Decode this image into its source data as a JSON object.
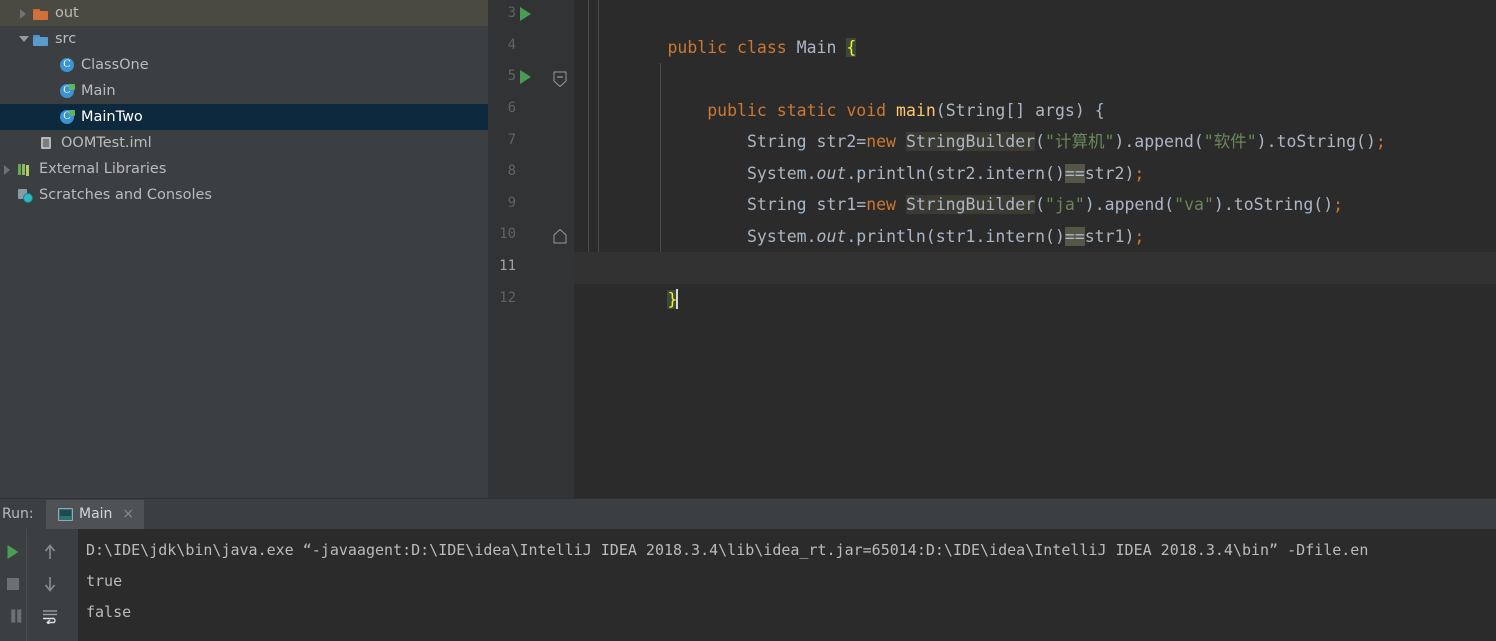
{
  "project_tree": {
    "items": [
      {
        "label": "out",
        "icon": "folder-orange-icon",
        "twisty": "collapsed",
        "indent": 16,
        "state": "hover"
      },
      {
        "label": "src",
        "icon": "folder-blue-icon",
        "twisty": "expanded",
        "indent": 16,
        "state": "normal"
      },
      {
        "label": "ClassOne",
        "icon": "java-class-icon",
        "twisty": "none",
        "indent": 58,
        "state": "normal"
      },
      {
        "label": "Main",
        "icon": "java-class-runnable-icon",
        "twisty": "none",
        "indent": 58,
        "state": "normal"
      },
      {
        "label": "MainTwo",
        "icon": "java-class-runnable-icon",
        "twisty": "none",
        "indent": 58,
        "state": "selected"
      },
      {
        "label": "OOMTest.iml",
        "icon": "module-iml-icon",
        "twisty": "none",
        "indent": 38,
        "state": "normal"
      },
      {
        "label": "External Libraries",
        "icon": "libraries-icon",
        "twisty": "collapsed",
        "indent": 16,
        "state": "normal"
      },
      {
        "label": "Scratches and Consoles",
        "icon": "scratches-icon",
        "twisty": "none",
        "indent": 16,
        "state": "normal"
      }
    ]
  },
  "editor": {
    "first_line": 3,
    "last_line": 12,
    "current_line": 11,
    "line_numbers": [
      "3",
      "4",
      "5",
      "6",
      "7",
      "8",
      "9",
      "10",
      "11",
      "12"
    ],
    "run_gutter_lines": [
      3,
      5
    ],
    "fold_lines": [
      5,
      10
    ],
    "lines": [
      {
        "n": 3,
        "indent": 0,
        "text": "public class Main {"
      },
      {
        "n": 4,
        "indent": 0,
        "text": ""
      },
      {
        "n": 5,
        "indent": 4,
        "text": "public static void main(String[] args) {"
      },
      {
        "n": 6,
        "indent": 8,
        "text": "String str2=new StringBuilder(\"计算机\").append(\"软件\").toString();"
      },
      {
        "n": 7,
        "indent": 8,
        "text": "System.out.println(str2.intern()==str2);"
      },
      {
        "n": 8,
        "indent": 8,
        "text": "String str1=new StringBuilder(\"ja\").append(\"va\").toString();"
      },
      {
        "n": 9,
        "indent": 8,
        "text": "System.out.println(str1.intern()==str1);"
      },
      {
        "n": 10,
        "indent": 4,
        "text": "}"
      },
      {
        "n": 11,
        "indent": 0,
        "text": "}"
      },
      {
        "n": 12,
        "indent": 0,
        "text": ""
      }
    ],
    "tokens": {
      "kw_public": "public",
      "kw_class": "class",
      "kw_static": "static",
      "kw_void": "void",
      "kw_new": "new",
      "type_main": "Main",
      "type_string": "String",
      "type_stringbuilder": "StringBuilder",
      "method_main": "main",
      "method_append": "append",
      "method_tostring": "toString",
      "method_intern": "intern",
      "method_println": "println",
      "field_out": "out",
      "class_system": "System",
      "var_args": "args",
      "var_str2": "str2",
      "var_str1": "str1",
      "str_jisuanji": "计算机",
      "str_ruanjian": "软件",
      "str_ja": "ja",
      "str_va": "va",
      "brace_open": "{",
      "brace_close": "}",
      "eq_eq": "==",
      "semi": ";"
    }
  },
  "run_panel": {
    "label": "Run:",
    "tab": {
      "title": "Main",
      "close": "×"
    },
    "toolbar": [
      {
        "name": "rerun-button",
        "icon": "run-icon"
      },
      {
        "name": "stop-button",
        "icon": "stop-icon"
      },
      {
        "name": "pause-button",
        "icon": "pause-icon"
      },
      {
        "name": "scroll-up-button",
        "icon": "arrow-up-icon"
      },
      {
        "name": "scroll-down-button",
        "icon": "arrow-down-icon"
      },
      {
        "name": "soft-wrap-button",
        "icon": "soft-wrap-icon"
      }
    ],
    "console_lines": [
      "D:\\IDE\\jdk\\bin\\java.exe “-javaagent:D:\\IDE\\idea\\IntelliJ IDEA 2018.3.4\\lib\\idea_rt.jar=65014:D:\\IDE\\idea\\IntelliJ IDEA 2018.3.4\\bin” -Dfile.en",
      "true",
      "false"
    ]
  },
  "colors": {
    "panel_bg": "#3c3f41",
    "editor_bg": "#2b2b2b",
    "gutter_bg": "#313335",
    "selection_bg": "#0d293e",
    "hover_bg": "#4a4a42",
    "keyword": "#cc7832",
    "string": "#6a8759",
    "method": "#ffc66d",
    "field": "#9876aa",
    "text": "#a9b7c6",
    "run_green": "#499c54"
  }
}
